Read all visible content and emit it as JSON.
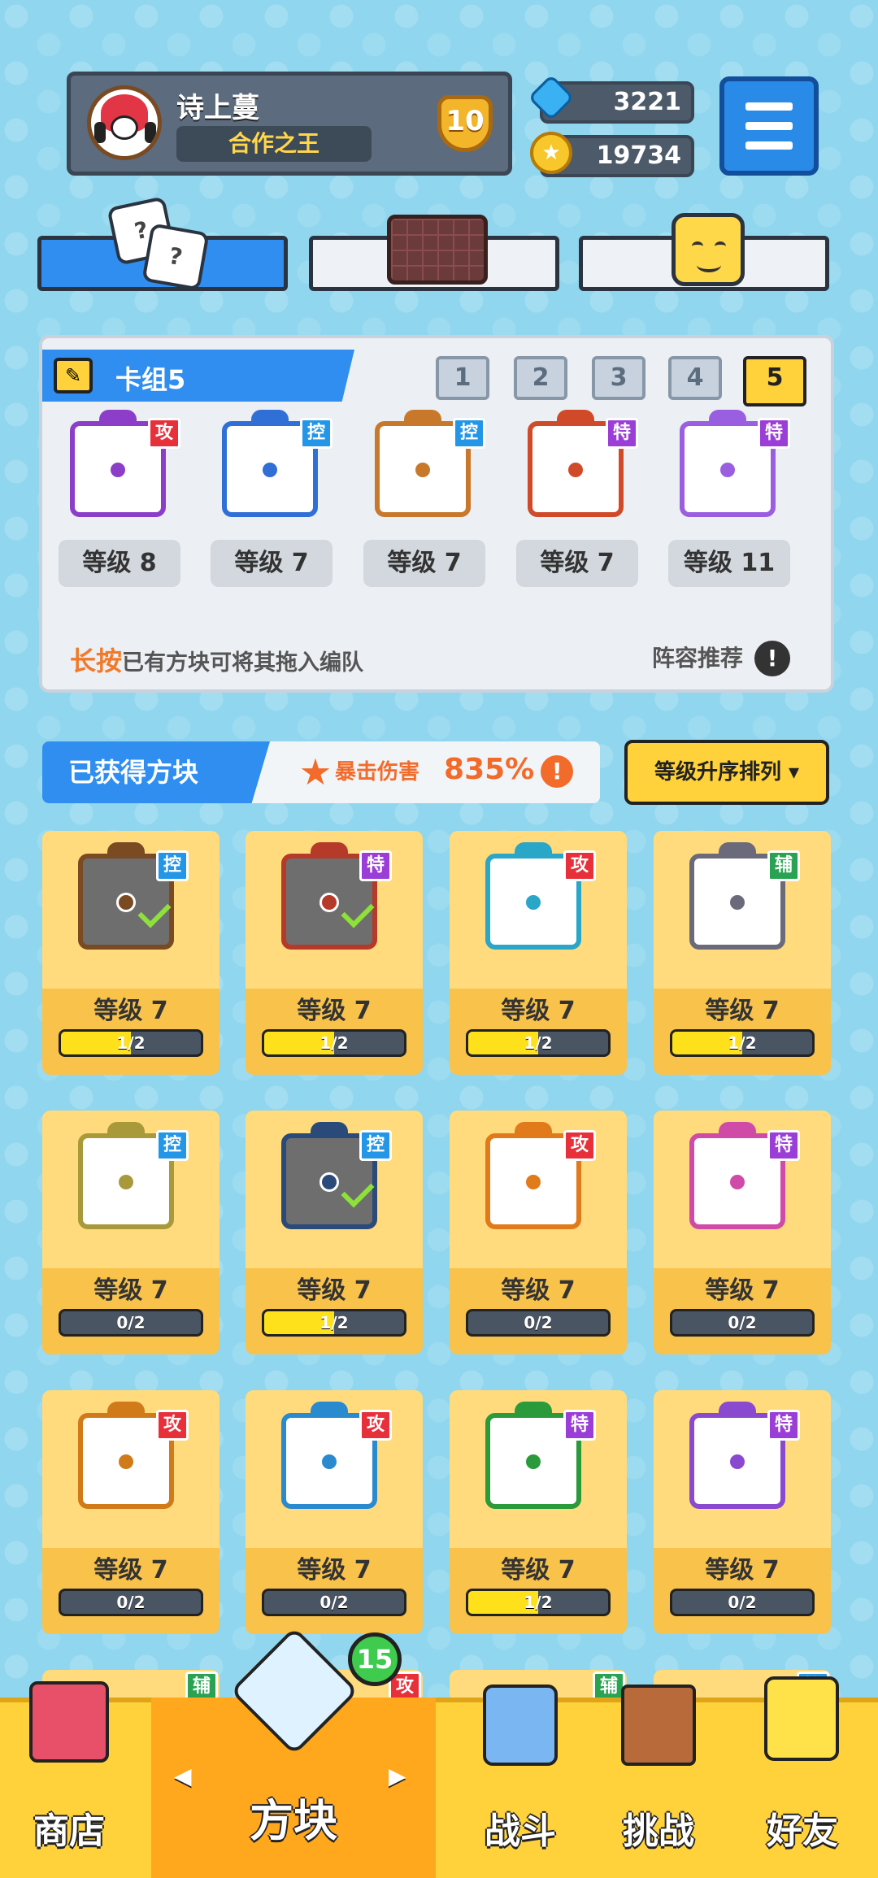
{
  "player": {
    "name": "诗上蔓",
    "title": "合作之王",
    "rank": "10"
  },
  "currency": {
    "gems": "3221",
    "coins": "19734"
  },
  "deck": {
    "title": "卡组5",
    "numbers": [
      "1",
      "2",
      "3",
      "4",
      "5"
    ],
    "active": "5",
    "cards": [
      {
        "tag": "攻",
        "type": "atk",
        "level": "等级 8",
        "color": "#8c3ec8"
      },
      {
        "tag": "控",
        "type": "ctrl",
        "level": "等级 7",
        "color": "#2f6fd6"
      },
      {
        "tag": "控",
        "type": "ctrl",
        "level": "等级 7",
        "color": "#c8782a"
      },
      {
        "tag": "特",
        "type": "spe",
        "level": "等级 7",
        "color": "#d04a2a"
      },
      {
        "tag": "特",
        "type": "spe",
        "level": "等级 11",
        "color": "#9a5ee0"
      }
    ],
    "hint_highlight": "长按",
    "hint_text": "已有方块可将其拖入编队",
    "recommend": "阵容推荐",
    "recommend_icon": "!"
  },
  "obtained": {
    "label": "已获得方块",
    "crit_label": "暴击伤害",
    "crit_value": "835%",
    "crit_icon": "!",
    "sort_label": "等级升序排列 ▾",
    "cards": [
      {
        "tag": "控",
        "type": "ctrl",
        "level": "等级 7",
        "progress": "1/2",
        "fill": 0.5,
        "owned": true,
        "color": "#7a4a22"
      },
      {
        "tag": "特",
        "type": "spe",
        "level": "等级 7",
        "progress": "1/2",
        "fill": 0.5,
        "owned": true,
        "color": "#b53a2a"
      },
      {
        "tag": "攻",
        "type": "atk",
        "level": "等级 7",
        "progress": "1/2",
        "fill": 0.5,
        "owned": false,
        "color": "#2aa6c8"
      },
      {
        "tag": "辅",
        "type": "sup",
        "level": "等级 7",
        "progress": "1/2",
        "fill": 0.5,
        "owned": false,
        "color": "#6a6a7a"
      },
      {
        "tag": "控",
        "type": "ctrl",
        "level": "等级 7",
        "progress": "0/2",
        "fill": 0,
        "owned": false,
        "color": "#a89a3a"
      },
      {
        "tag": "控",
        "type": "ctrl",
        "level": "等级 7",
        "progress": "1/2",
        "fill": 0.5,
        "owned": true,
        "color": "#2a4a7a"
      },
      {
        "tag": "攻",
        "type": "atk",
        "level": "等级 7",
        "progress": "0/2",
        "fill": 0,
        "owned": false,
        "color": "#e07a1a"
      },
      {
        "tag": "特",
        "type": "spe",
        "level": "等级 7",
        "progress": "0/2",
        "fill": 0,
        "owned": false,
        "color": "#d04aa8"
      },
      {
        "tag": "攻",
        "type": "atk",
        "level": "等级 7",
        "progress": "0/2",
        "fill": 0,
        "owned": false,
        "color": "#d07a1a"
      },
      {
        "tag": "攻",
        "type": "atk",
        "level": "等级 7",
        "progress": "0/2",
        "fill": 0,
        "owned": false,
        "color": "#2a8ad0"
      },
      {
        "tag": "特",
        "type": "spe",
        "level": "等级 7",
        "progress": "1/2",
        "fill": 0.5,
        "owned": false,
        "color": "#2a9a3a"
      },
      {
        "tag": "特",
        "type": "spe",
        "level": "等级 7",
        "progress": "0/2",
        "fill": 0,
        "owned": false,
        "color": "#8a4ad0"
      }
    ],
    "partial_tags": [
      "辅",
      "攻",
      "辅",
      "控"
    ]
  },
  "nav": {
    "shop": "商店",
    "blocks": "方块",
    "battle": "战斗",
    "challenge": "挑战",
    "friends": "好友",
    "badge": "15",
    "prev": "◀",
    "next": "▶"
  },
  "tab_dice_text": "?"
}
